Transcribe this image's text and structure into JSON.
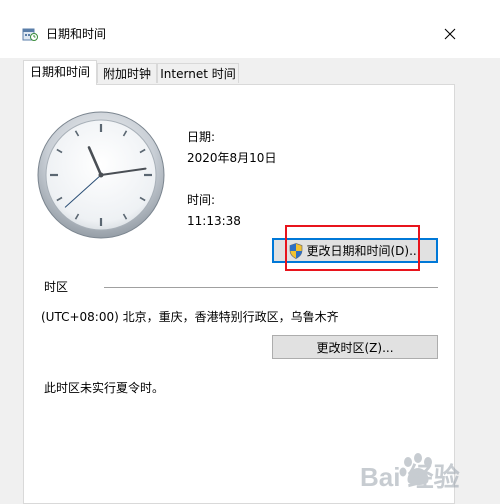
{
  "window": {
    "title": "日期和时间",
    "close_symbol": "✕"
  },
  "tabs": [
    {
      "label": "日期和时间",
      "active": true
    },
    {
      "label": "附加时钟",
      "active": false
    },
    {
      "label": "Internet 时间",
      "active": false
    }
  ],
  "datetime": {
    "date_label": "日期:",
    "date_value": "2020年8月10日",
    "time_label": "时间:",
    "time_value": "11:13:38",
    "change_button": "更改日期和时间(D)..."
  },
  "timezone": {
    "section_label": "时区",
    "value": "(UTC+08:00) 北京，重庆，香港特别行政区，乌鲁木齐",
    "change_button": "更改时区(Z)...",
    "dst_note": "此时区未实行夏令时。"
  },
  "clock": {
    "hour": 11,
    "minute": 13,
    "second": 38
  },
  "watermark": {
    "text": "Bai 经验"
  },
  "colors": {
    "highlight": "#e8141c",
    "focus": "#0078d7",
    "button_bg": "#e1e1e1"
  }
}
